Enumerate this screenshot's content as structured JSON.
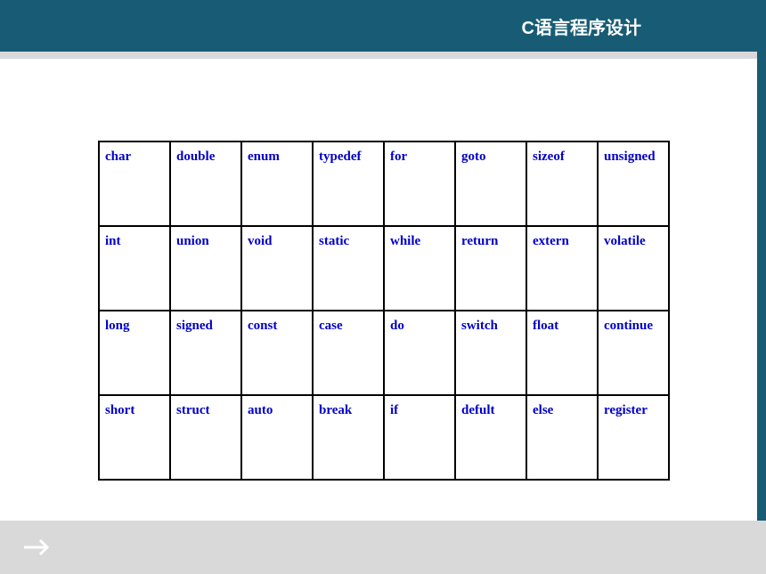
{
  "header": {
    "title": "C语言程序设计"
  },
  "table": {
    "rows": [
      [
        "char",
        "double",
        "enum",
        "typedef",
        "for",
        "goto",
        "sizeof",
        "unsigned"
      ],
      [
        "int",
        "union",
        "void",
        "static",
        "while",
        "return",
        "extern",
        "volatile"
      ],
      [
        "long",
        "signed",
        "const",
        "case",
        "do",
        "switch",
        "float",
        "continue"
      ],
      [
        "short",
        "struct",
        "auto",
        "break",
        "if",
        "defult",
        "else",
        "register"
      ]
    ]
  }
}
